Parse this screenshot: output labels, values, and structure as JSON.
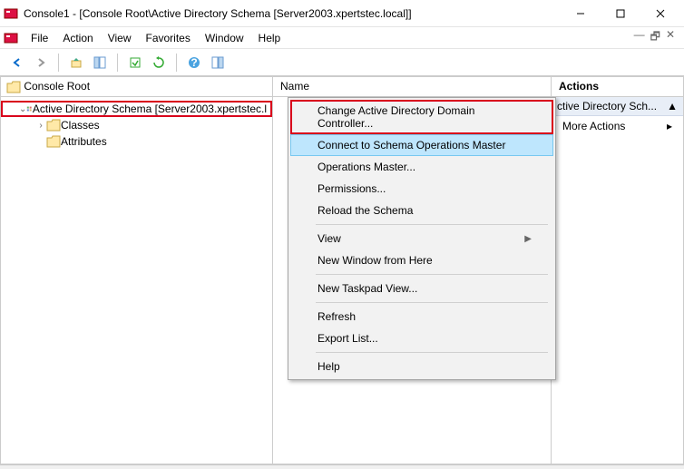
{
  "window": {
    "title": "Console1 - [Console Root\\Active Directory Schema [Server2003.xpertstec.local]]"
  },
  "menubar": {
    "items": [
      "File",
      "Action",
      "View",
      "Favorites",
      "Window",
      "Help"
    ]
  },
  "tree": {
    "header": "Console Root",
    "root_label": "Active Directory Schema [Server2003.xpertstec.l",
    "classes_label": "Classes",
    "attributes_label": "Attributes"
  },
  "list": {
    "header": "Name"
  },
  "actions": {
    "title": "Actions",
    "subtitle": "ctive Directory Sch...",
    "more": "More Actions"
  },
  "context_menu": {
    "change_dc": "Change Active Directory Domain Controller...",
    "connect_schema": "Connect to Schema Operations Master",
    "operations_master": "Operations Master...",
    "permissions": "Permissions...",
    "reload": "Reload the Schema",
    "view": "View",
    "new_window": "New Window from Here",
    "new_taskpad": "New Taskpad View...",
    "refresh": "Refresh",
    "export_list": "Export List...",
    "help": "Help"
  }
}
